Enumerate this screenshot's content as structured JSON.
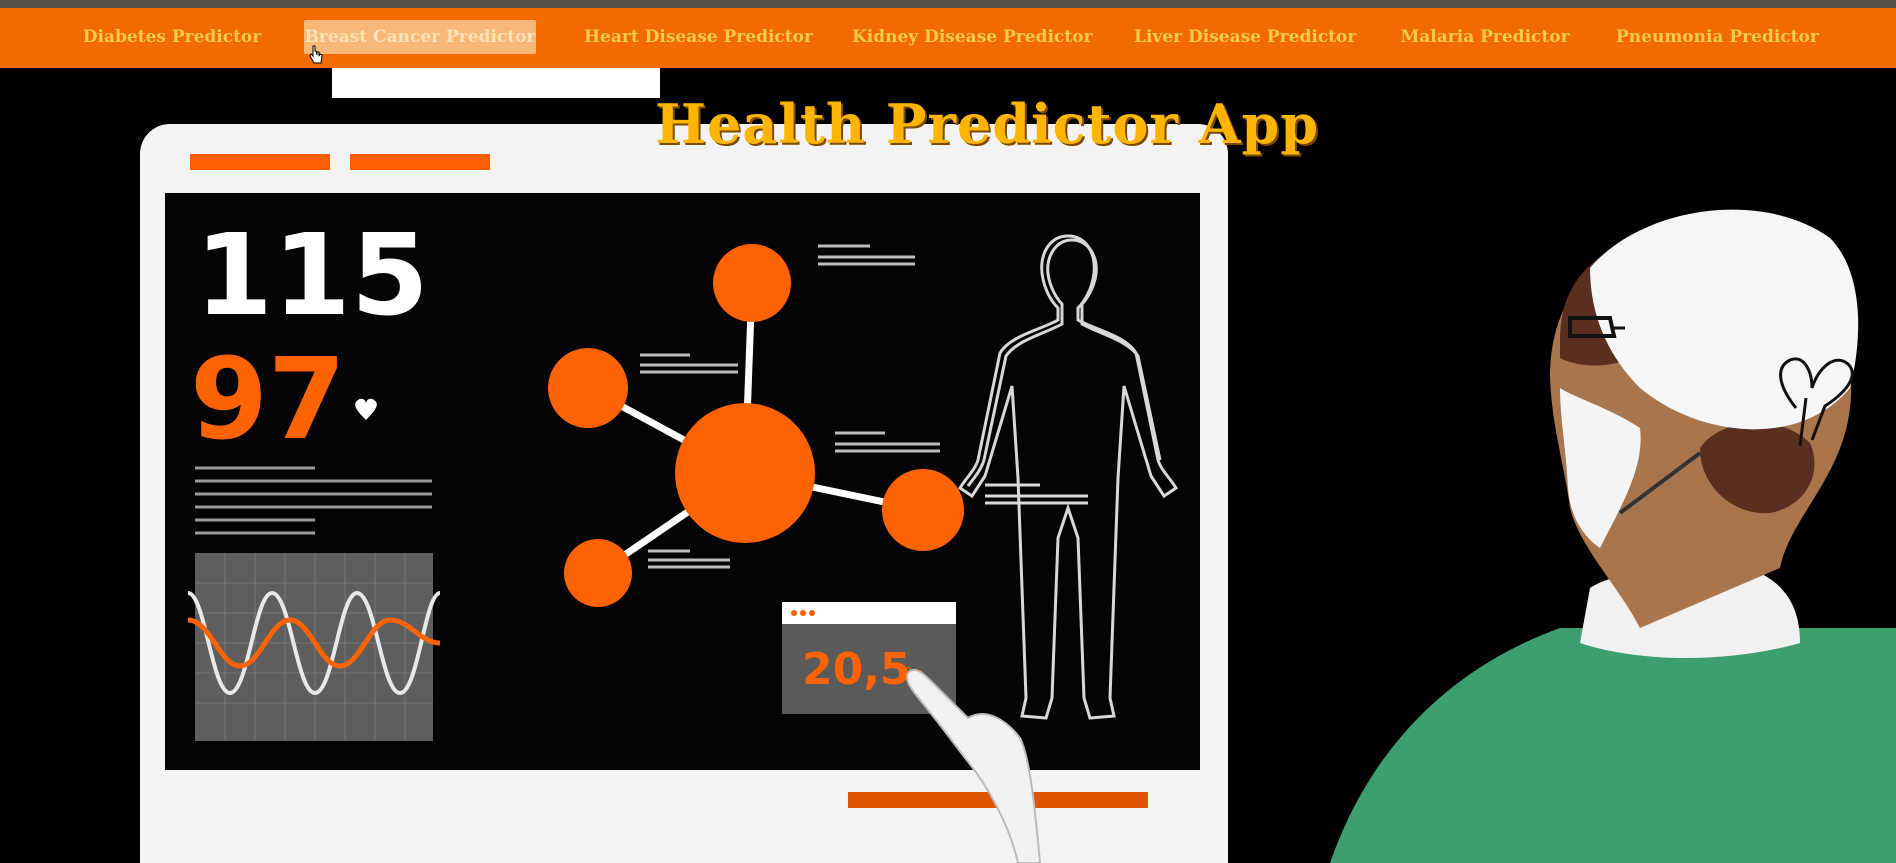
{
  "nav": {
    "items": [
      {
        "label": "Diabetes Predictor"
      },
      {
        "label": "Breast Cancer Predictor"
      },
      {
        "label": "Heart Disease Predictor"
      },
      {
        "label": "Kidney Disease Predictor"
      },
      {
        "label": "Liver Disease Predictor"
      },
      {
        "label": "Malaria Predictor"
      },
      {
        "label": "Pneumonia Predictor"
      }
    ],
    "active_index": 1
  },
  "hero": {
    "title": "Health Predictor App",
    "screen_value_1": "115",
    "screen_value_2": "97",
    "card_value": "20,5"
  },
  "colors": {
    "nav_bg": "#f26b00",
    "nav_text": "#f7c94a",
    "title": "#ffb400",
    "accent": "#ff6200",
    "scrubs": "#3d9f6e"
  }
}
